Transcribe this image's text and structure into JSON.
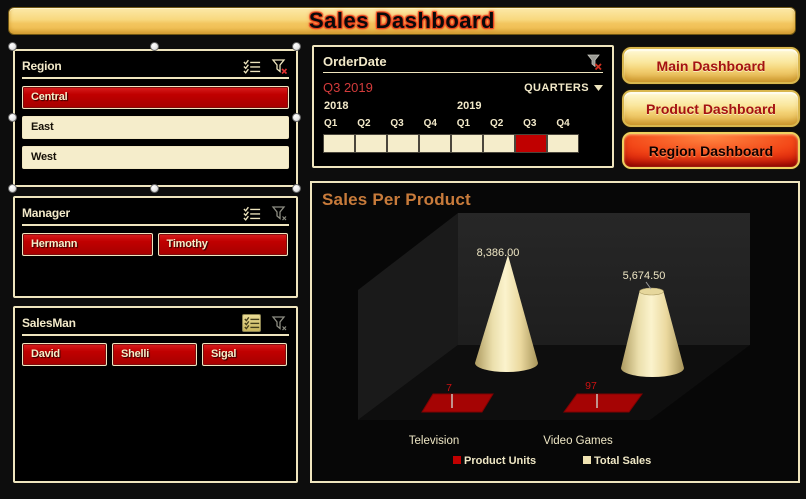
{
  "title": "Sales Dashboard",
  "slicers": {
    "region": {
      "header": "Region",
      "items": [
        {
          "label": "Central",
          "selected": true
        },
        {
          "label": "East",
          "selected": false
        },
        {
          "label": "West",
          "selected": false
        }
      ]
    },
    "manager": {
      "header": "Manager",
      "items": [
        {
          "label": "Hermann",
          "selected": true
        },
        {
          "label": "Timothy",
          "selected": true
        }
      ]
    },
    "salesman": {
      "header": "SalesMan",
      "items": [
        {
          "label": "David",
          "selected": true
        },
        {
          "label": "Shelli",
          "selected": true
        },
        {
          "label": "Sigal",
          "selected": true
        }
      ]
    }
  },
  "timeline": {
    "header": "OrderDate",
    "selection_label": "Q3 2019",
    "period_level": "QUARTERS",
    "years": [
      "2018",
      "2019"
    ],
    "quarters": [
      "Q1",
      "Q2",
      "Q3",
      "Q4",
      "Q1",
      "Q2",
      "Q3",
      "Q4"
    ],
    "selected_quarter_index": 6
  },
  "nav": {
    "buttons": [
      {
        "label": "Main Dashboard",
        "active": false
      },
      {
        "label": "Product Dashboard",
        "active": false
      },
      {
        "label": "Region Dashboard",
        "active": true
      }
    ]
  },
  "chart_data": {
    "type": "bar",
    "subtype": "3d-cone",
    "title": "Sales Per Product",
    "categories": [
      "Television",
      "Video Games"
    ],
    "series": [
      {
        "name": "Product Units",
        "color": "#C00000",
        "values": [
          7,
          97
        ],
        "labels": [
          "7",
          "97"
        ]
      },
      {
        "name": "Total Sales",
        "color": "#F0E3B2",
        "values": [
          8386.0,
          5674.5
        ],
        "labels": [
          "8,386.00",
          "5,674.50"
        ]
      }
    ],
    "legend_position": "bottom",
    "grid": false
  },
  "colors": {
    "accent_red": "#C00000",
    "cream": "#F2E8C4",
    "gold": "#F0C75A",
    "chart_title_orange": "#C87B3B",
    "timeline_selection_red": "#D23B3B"
  }
}
